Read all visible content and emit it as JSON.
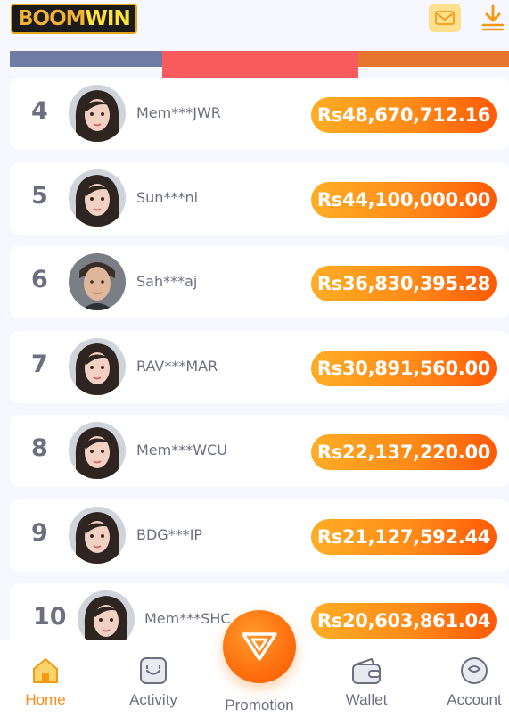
{
  "header": {
    "logo_part1": "BOOM",
    "logo_part2": "WIN"
  },
  "leaderboard": [
    {
      "rank": "4",
      "name": "Mem***JWR",
      "amount": "Rs48,670,712.16",
      "avatar": "female"
    },
    {
      "rank": "5",
      "name": "Sun***ni",
      "amount": "Rs44,100,000.00",
      "avatar": "female"
    },
    {
      "rank": "6",
      "name": "Sah***aj",
      "amount": "Rs36,830,395.28",
      "avatar": "male"
    },
    {
      "rank": "7",
      "name": "RAV***MAR",
      "amount": "Rs30,891,560.00",
      "avatar": "female"
    },
    {
      "rank": "8",
      "name": "Mem***WCU",
      "amount": "Rs22,137,220.00",
      "avatar": "female"
    },
    {
      "rank": "9",
      "name": "BDG***IP",
      "amount": "Rs21,127,592.44",
      "avatar": "female"
    },
    {
      "rank": "10",
      "name": "Mem***SHC",
      "amount": "Rs20,603,861.04",
      "avatar": "female"
    }
  ],
  "nav": {
    "home": "Home",
    "activity": "Activity",
    "promotion": "Promotion",
    "wallet": "Wallet",
    "account": "Account"
  },
  "colors": {
    "accent": "#ff8a17",
    "text_muted": "#6d6f80",
    "mail_bg": "#ffe08f"
  }
}
